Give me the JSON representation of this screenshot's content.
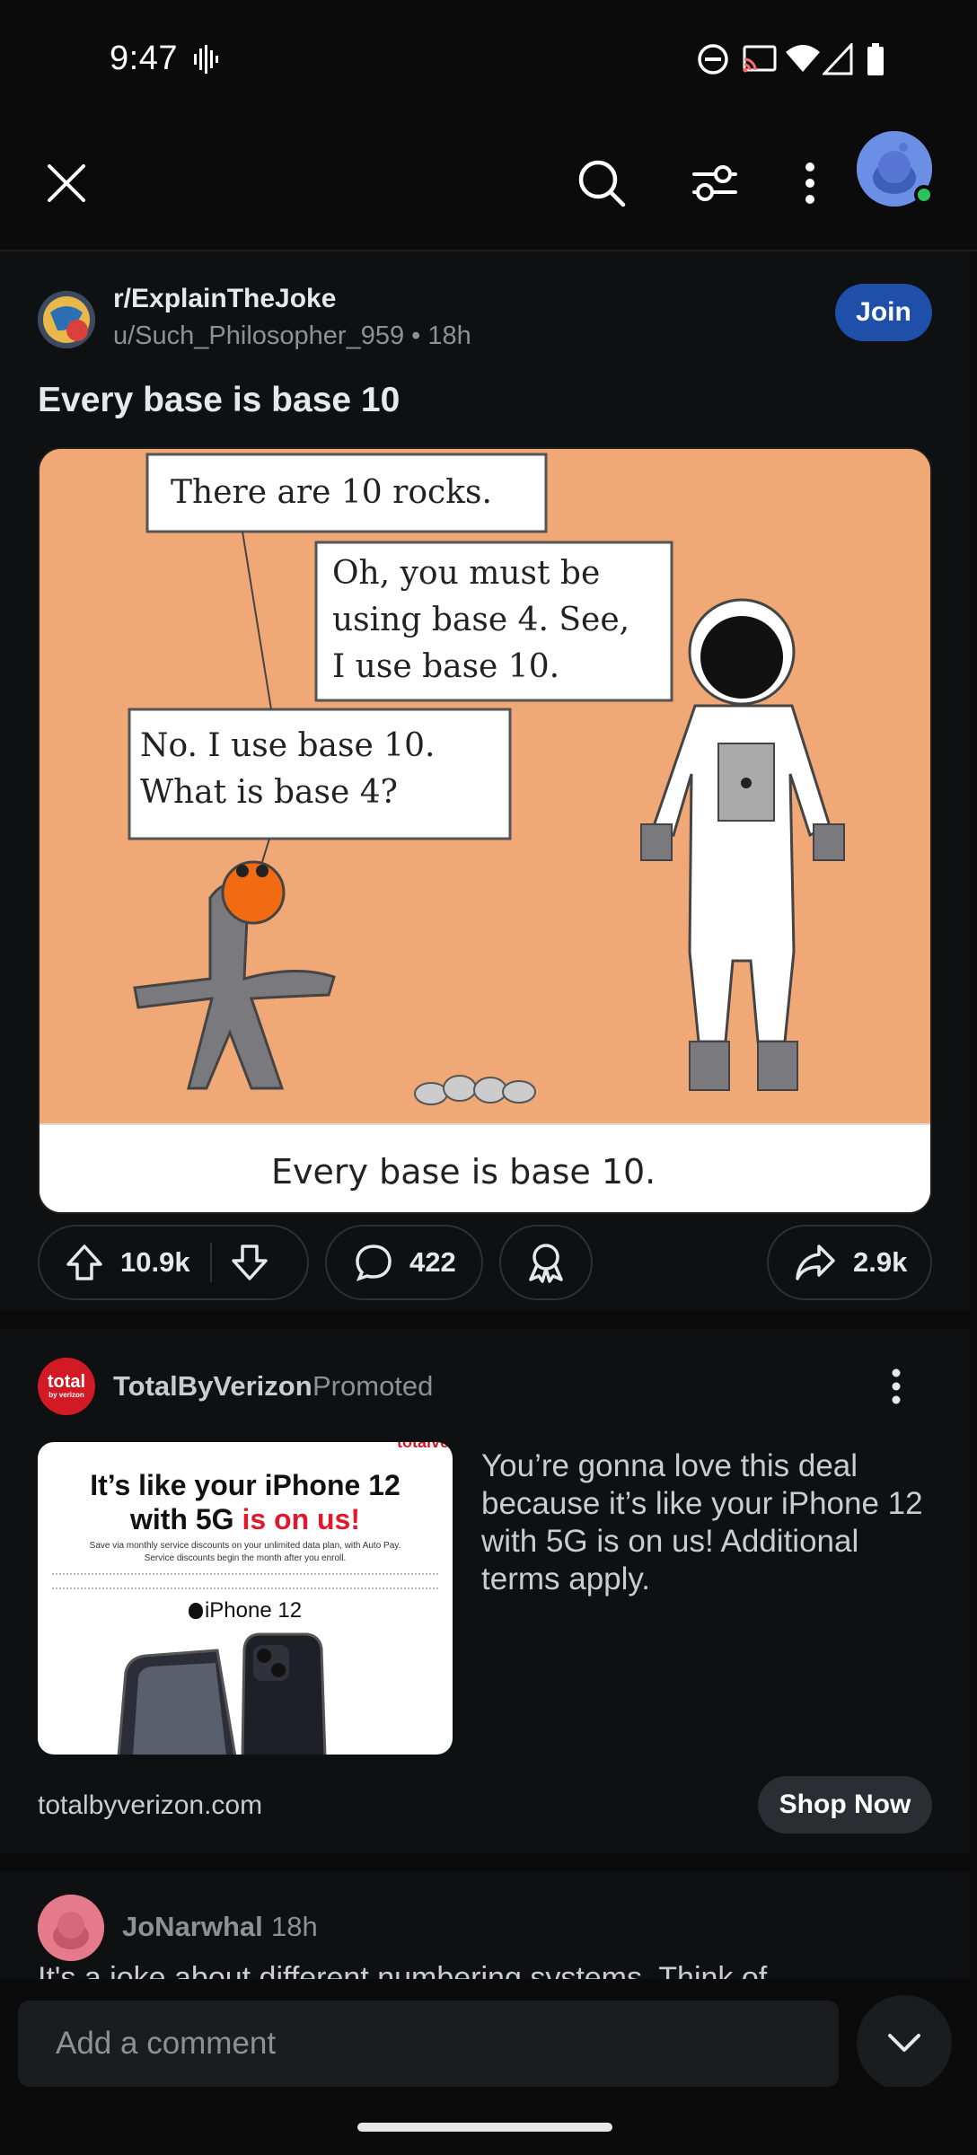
{
  "status_bar": {
    "time": "9:47"
  },
  "app_bar": {
    "icons": [
      "close-icon",
      "search-icon",
      "sort-icon",
      "more-vertical-icon",
      "avatar"
    ]
  },
  "post": {
    "subreddit": "r/ExplainTheJoke",
    "author_line": "u/Such_Philosopher_959 • 18h",
    "join_label": "Join",
    "title": "Every base is base 10",
    "comic": {
      "bubble1": "There are 10 rocks.",
      "bubble2_lines": [
        "Oh, you must be",
        "using base 4.  See,",
        "I use base 10."
      ],
      "bubble3_lines": [
        "No.  I use base 10.",
        "What is base 4?"
      ],
      "caption": "Every base is base 10."
    },
    "upvotes": "10.9k",
    "comments": "422",
    "shares": "2.9k"
  },
  "ad": {
    "advertiser": "TotalByVerizon",
    "promoted_label": "Promoted",
    "avatar_text_top": "total",
    "avatar_text_bottom": "by verizon",
    "image_brand": "totalverizon",
    "image_headline_1": "It’s like your iPhone 12",
    "image_headline_2a": "with 5G ",
    "image_headline_2b": "is on us!",
    "image_sub_1": "Save via monthly service discounts on your unlimited data plan, with Auto Pay.",
    "image_sub_2": "Service discounts begin the month after you enroll.",
    "image_product": "iPhone 12",
    "body": "You’re gonna love this deal because it’s like your iPhone 12 with 5G is on us! Additional terms apply.",
    "domain": "totalbyverizon.com",
    "cta": "Shop Now"
  },
  "comment": {
    "author": "JoNarwhal",
    "time": "18h",
    "body": "It's a joke about different numbering systems. Think of"
  },
  "composer": {
    "placeholder": "Add a comment"
  }
}
